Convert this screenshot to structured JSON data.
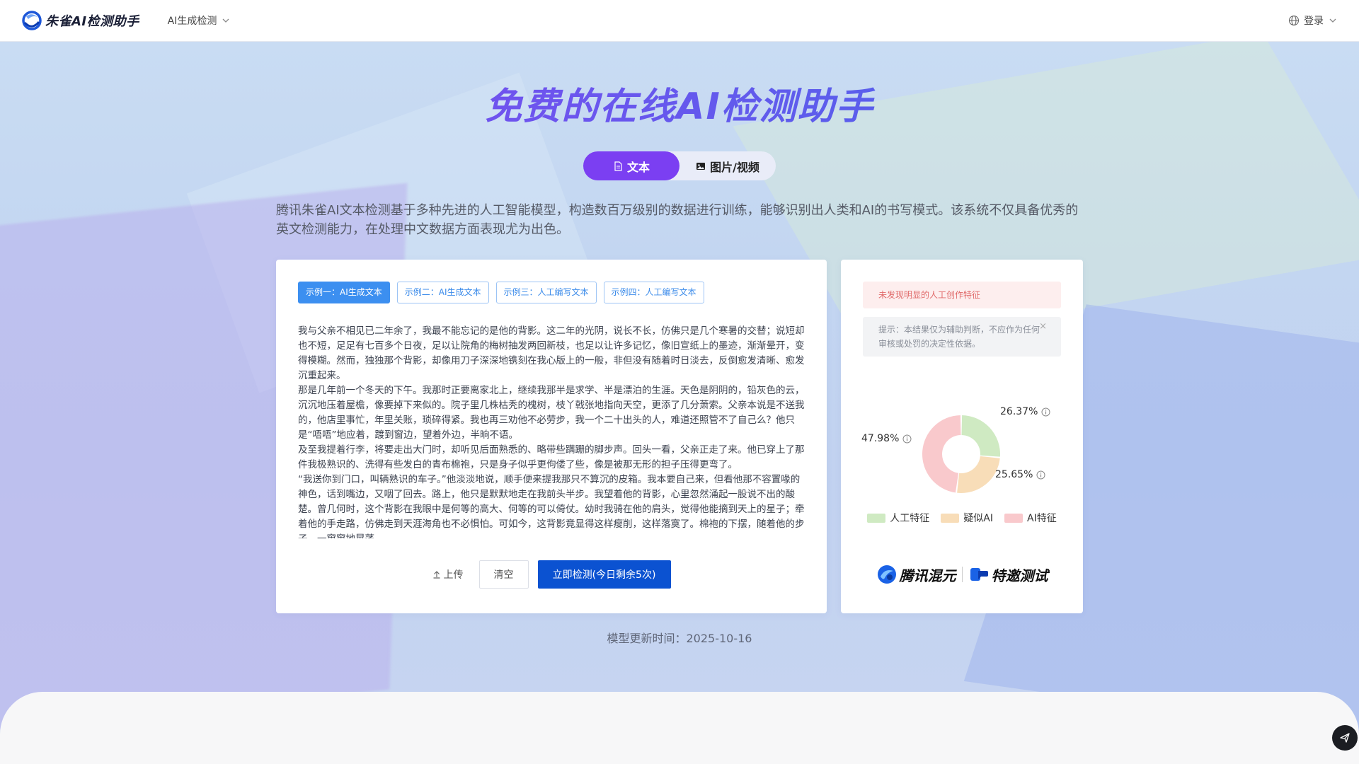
{
  "header": {
    "logo_text": "朱雀AI检测助手",
    "nav_label": "AI生成检测",
    "login_label": "登录"
  },
  "hero": {
    "title": "免费的在线AI检测助手",
    "tabs": [
      {
        "label": "文本",
        "active": true
      },
      {
        "label": "图片/视频",
        "active": false
      }
    ],
    "intro": "腾讯朱雀AI文本检测基于多种先进的人工智能模型，构造数百万级别的数据进行训练，能够识别出人类和AI的书写模式。该系统不仅具备优秀的英文检测能力，在处理中文数据方面表现尤为出色。"
  },
  "examples": [
    {
      "label": "示例一：AI生成文本",
      "active": true
    },
    {
      "label": "示例二：AI生成文本",
      "active": false
    },
    {
      "label": "示例三：人工编写文本",
      "active": false
    },
    {
      "label": "示例四：人工编写文本",
      "active": false
    }
  ],
  "input_text": [
    "我与父亲不相见已二年余了，我最不能忘记的是他的背影。这二年的光阴，说长不长，仿佛只是几个寒暑的交替；说短却也不短，足足有七百多个日夜，足以让院角的梅树抽发两回新枝，也足以让许多记忆，像旧宣纸上的墨迹，渐渐晕开，变得模糊。然而，独独那个背影，却像用刀子深深地镌刻在我心版上的一般，非但没有随着时日淡去，反倒愈发清晰、愈发沉重起来。",
    "那是几年前一个冬天的下午。我那时正要离家北上，继续我那半是求学、半是漂泊的生涯。天色是阴阴的，铅灰色的云，沉沉地压着屋檐，像要掉下来似的。院子里几株枯秃的槐树，枝丫戟张地指向天空，更添了几分萧索。父亲本说是不送我的，他店里事忙，年里关账，琐碎得紧。我也再三劝他不必劳步，我一个二十出头的人，难道还照管不了自己么？他只是“唔唔”地应着，踱到窗边，望着外边，半晌不语。",
    "及至我提着行李，将要走出大门时，却听见后面熟悉的、略带些蹒跚的脚步声。回头一看，父亲正走了来。他已穿上了那件我极熟识的、洗得有些发白的青布棉袍，只是身子似乎更佝偻了些，像是被那无形的担子压得更弯了。",
    "“我送你到门口，叫辆熟识的车子。”他淡淡地说，顺手便来提我那只不算沉的皮箱。我本要自己来，但看他那不容置喙的神色，话到嘴边，又咽了回去。路上，他只是默默地走在我前头半步。我望着他的背影，心里忽然涌起一股说不出的酸楚。曾几何时，这个背影在我眼中是何等的高大、何等的可以倚仗。幼时我骑在他的肩头，觉得他能摘到天上的星子；牵着他的手走路，仿佛走到天涯海角也不必惧怕。可如今，这背影竟显得这样瘦削，这样落寞了。棉袍的下摆，随着他的步子，一窜窜地晃荡。"
  ],
  "actions": {
    "upload_label": "上传",
    "clear_label": "清空",
    "detect_label": "立即检测(今日剩余5次)"
  },
  "result": {
    "banner": "未发现明显的人工创作特征",
    "hint": "提示：本结果仅为辅助判断，不应作为任何审核或处罚的决定性依据。",
    "hint_close": "×",
    "chart_data": {
      "type": "pie",
      "categories": [
        "人工特征",
        "疑似AI",
        "AI特征"
      ],
      "values": [
        26.37,
        25.65,
        47.98
      ],
      "labels": [
        "26.37%",
        "25.65%",
        "47.98%"
      ],
      "colors": [
        "#cfeac2",
        "#f8ddb8",
        "#f9c9cc"
      ],
      "legend_position": "bottom"
    },
    "partner": {
      "left_text": "腾讯混元",
      "right_text": "特邀测试"
    }
  },
  "update_time": "模型更新时间：2025-10-16"
}
